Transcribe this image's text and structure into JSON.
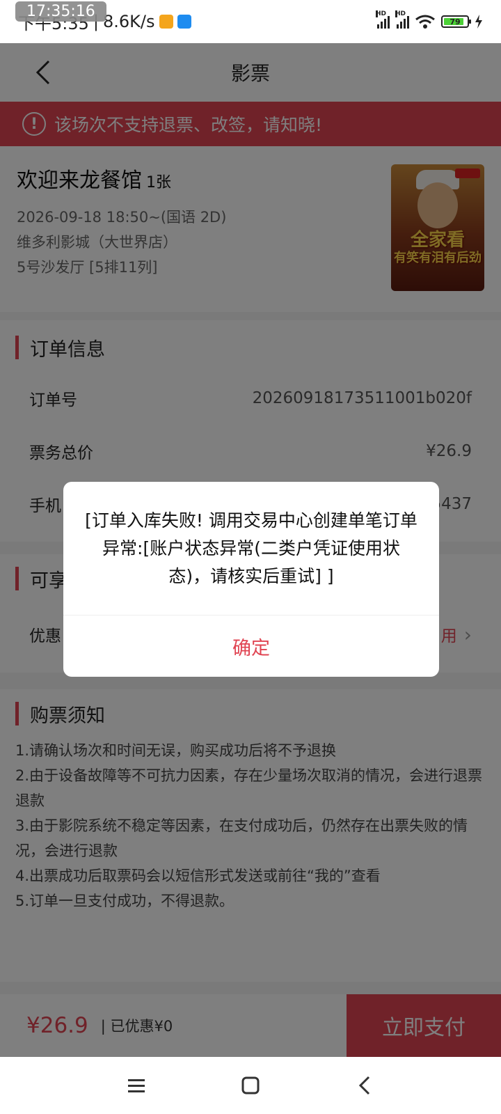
{
  "status_bar": {
    "time_text": "下午5:35",
    "speed": "8.6K/s",
    "time_overlay": "17:35:16",
    "battery": "79",
    "hd1": "HD",
    "hd2": "HD"
  },
  "header": {
    "title": "影票"
  },
  "warning": {
    "text": "该场次不支持退票、改签，请知晓!"
  },
  "movie": {
    "title": "欢迎来龙餐馆",
    "count": "1张",
    "showtime": "2026-09-18 18:50~(国语 2D)",
    "cinema": "维多利影城（大世界店）",
    "hall": "5号沙发厅 [5排11列]",
    "poster_text_1": "全家看",
    "poster_text_2": "有笑有泪有后劲"
  },
  "order_info": {
    "title": "订单信息",
    "rows": [
      {
        "label": "订单号",
        "value": "20260918173511001b020f"
      },
      {
        "label": "票务总价",
        "value": "¥26.9"
      },
      {
        "label": "手机",
        "value": "5437"
      }
    ]
  },
  "offers": {
    "title": "可享",
    "row_label": "优惠",
    "row_value": "用"
  },
  "notice": {
    "title": "购票须知",
    "lines": [
      "1.请确认场次和时间无误，购买成功后将不予退换",
      "2.由于设备故障等不可抗力因素，存在少量场次取消的情况，会进行退票退款",
      "3.由于影院系统不稳定等因素，在支付成功后，仍然存在出票失败的情况，会进行退款",
      "4.出票成功后取票码会以短信形式发送或前往“我的”查看",
      "5.订单一旦支付成功，不得退款。"
    ]
  },
  "bottom_bar": {
    "price": "¥26.9",
    "discount": "| 已优惠¥0",
    "pay_label": "立即支付"
  },
  "dialog": {
    "message": "[订单入库失败! 调用交易中心创建单笔订单异常:[账户状态异常(二类户凭证使用状态)，请核实后重试] ]",
    "confirm_label": "确定"
  },
  "colors": {
    "accent": "#e04452",
    "overlay": "rgba(0,0,0,0.5)"
  }
}
